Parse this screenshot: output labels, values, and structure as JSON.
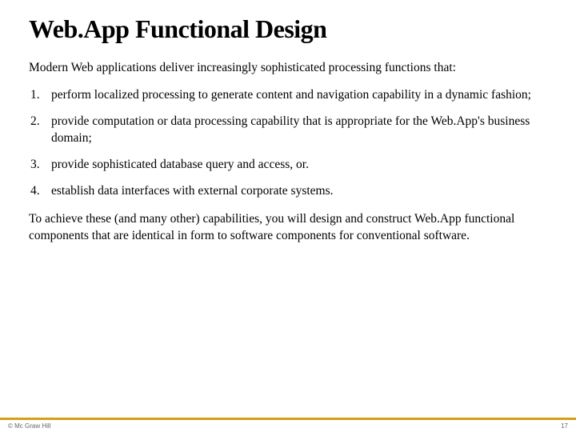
{
  "title": "Web.App Functional Design",
  "intro": "Modern Web applications deliver increasingly sophisticated processing functions that:",
  "items": [
    {
      "number": "1.",
      "text": "perform localized processing to generate content and navigation capability in a dynamic fashion;"
    },
    {
      "number": "2.",
      "text": "provide computation or data processing capability that is appropriate for the Web.App's business domain;"
    },
    {
      "number": "3.",
      "text": "provide sophisticated database query and access, or."
    },
    {
      "number": "4.",
      "text": "establish data interfaces with external corporate systems."
    }
  ],
  "conclusion": "To achieve these (and many other) capabilities, you will design and construct Web.App functional components that are identical in form to software components for conventional software.",
  "footer": {
    "left": "© Mc Graw Hill",
    "right": "17"
  }
}
